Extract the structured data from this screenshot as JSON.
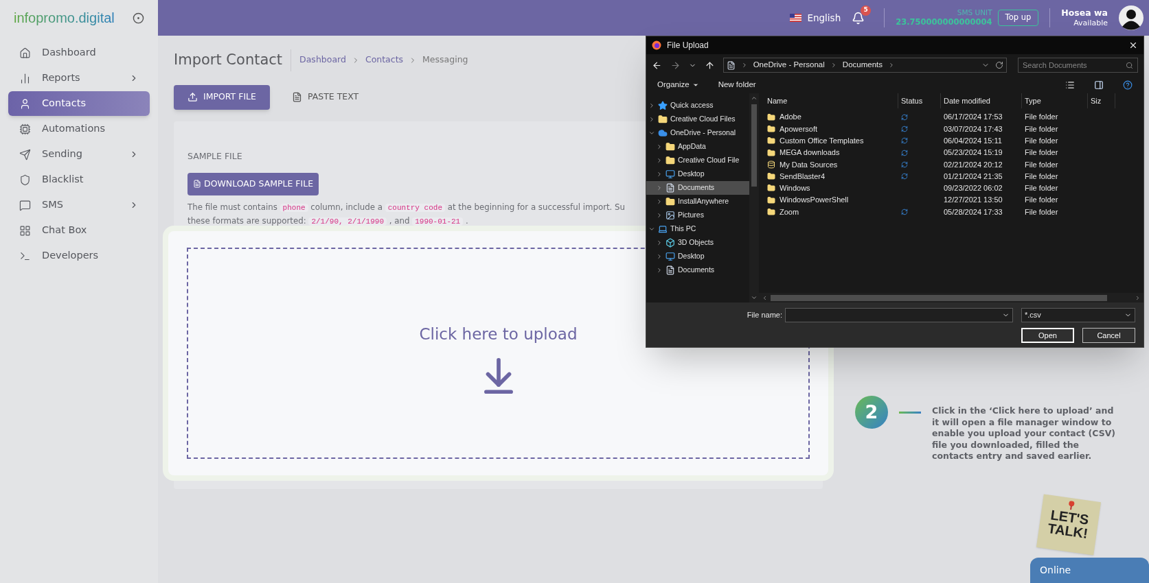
{
  "sidebar": {
    "logo": "infopromo.digital",
    "items": [
      {
        "label": "Dashboard",
        "submenu": false,
        "selected": false
      },
      {
        "label": "Reports",
        "submenu": true,
        "selected": false
      },
      {
        "label": "Contacts",
        "submenu": false,
        "selected": true
      },
      {
        "label": "Automations",
        "submenu": false,
        "selected": false
      },
      {
        "label": "Sending",
        "submenu": true,
        "selected": false
      },
      {
        "label": "Blacklist",
        "submenu": false,
        "selected": false
      },
      {
        "label": "SMS",
        "submenu": true,
        "selected": false
      },
      {
        "label": "Chat Box",
        "submenu": false,
        "selected": false
      },
      {
        "label": "Developers",
        "submenu": false,
        "selected": false
      }
    ]
  },
  "topbar": {
    "language": "English",
    "notifications": "5",
    "sms_label": "SMS UNIT",
    "sms_value": "23.750000000000004",
    "topup": "Top up",
    "user": "Hosea wa",
    "status": "Available"
  },
  "page": {
    "title": "Import Contact",
    "breadcrumbs": [
      {
        "label": "Dashboard",
        "link": true
      },
      {
        "label": "Contacts",
        "link": true
      },
      {
        "label": "Messaging",
        "link": false
      }
    ],
    "tabs": [
      {
        "label": "IMPORT FILE",
        "selected": true
      },
      {
        "label": "PASTE TEXT",
        "selected": false
      }
    ],
    "section_label": "SAMPLE FILE",
    "download_button": "DOWNLOAD SAMPLE FILE",
    "note_lines": [
      [
        {
          "kind": "text",
          "text": "The file must contains "
        },
        {
          "kind": "code",
          "text": "phone"
        },
        {
          "kind": "text",
          "text": " column, include a "
        },
        {
          "kind": "code",
          "text": "country code"
        },
        {
          "kind": "text",
          "text": " at the beginning for a successful import. Su"
        }
      ],
      [
        {
          "kind": "text",
          "text": "these formats are supported: "
        },
        {
          "kind": "code",
          "text": "2/1/90, 2/1/1990"
        },
        {
          "kind": "text",
          "text": " , and "
        },
        {
          "kind": "code",
          "text": "1990-01-21"
        },
        {
          "kind": "text",
          "text": " ."
        }
      ]
    ],
    "upload_text": "Click here to upload"
  },
  "dialog": {
    "title": "File Upload",
    "path": [
      "OneDrive - Personal",
      "Documents"
    ],
    "search_placeholder": "Search Documents",
    "toolbar": [
      {
        "label": "Organize",
        "dropdown": true
      },
      {
        "label": "New folder",
        "dropdown": false
      }
    ],
    "columns": [
      "Name",
      "Status",
      "Date modified",
      "Type",
      "Siz"
    ],
    "tree": [
      {
        "label": "Quick access",
        "kind": "star",
        "expanded": false,
        "selected": false
      },
      {
        "label": "Creative Cloud Files",
        "kind": "folder",
        "expanded": false,
        "selected": false
      },
      {
        "label": "OneDrive - Personal",
        "kind": "cloud",
        "expanded": true,
        "selected": false,
        "children": [
          {
            "label": "AppData",
            "kind": "folder",
            "expanded": false,
            "selected": false
          },
          {
            "label": "Creative Cloud File",
            "kind": "folder",
            "expanded": false,
            "selected": false
          },
          {
            "label": "Desktop",
            "kind": "desktop",
            "expanded": false,
            "selected": false
          },
          {
            "label": "Documents",
            "kind": "document",
            "expanded": false,
            "selected": true
          },
          {
            "label": "InstallAnywhere",
            "kind": "folder",
            "expanded": false,
            "selected": false
          },
          {
            "label": "Pictures",
            "kind": "picture",
            "expanded": false,
            "selected": false
          }
        ]
      },
      {
        "label": "This PC",
        "kind": "pc",
        "expanded": true,
        "selected": false,
        "children": [
          {
            "label": "3D Objects",
            "kind": "cube",
            "expanded": false,
            "selected": false
          },
          {
            "label": "Desktop",
            "kind": "desktop",
            "expanded": false,
            "selected": false
          },
          {
            "label": "Documents",
            "kind": "document",
            "expanded": false,
            "selected": false
          }
        ]
      }
    ],
    "files": [
      {
        "name": "Adobe",
        "kind": "folder",
        "synced": true,
        "date": "06/17/2024 17:53",
        "type": "File folder"
      },
      {
        "name": "Apowersoft",
        "kind": "folder",
        "synced": true,
        "date": "03/07/2024 17:43",
        "type": "File folder"
      },
      {
        "name": "Custom Office Templates",
        "kind": "folder",
        "synced": true,
        "date": "06/04/2024 15:11",
        "type": "File folder"
      },
      {
        "name": "MEGA downloads",
        "kind": "folder",
        "synced": true,
        "date": "05/23/2024 15:19",
        "type": "File folder"
      },
      {
        "name": "My Data Sources",
        "kind": "datasource",
        "synced": true,
        "date": "02/21/2024 20:12",
        "type": "File folder"
      },
      {
        "name": "SendBlaster4",
        "kind": "folder",
        "synced": true,
        "date": "01/21/2024 21:35",
        "type": "File folder"
      },
      {
        "name": "Windows",
        "kind": "folder",
        "synced": false,
        "date": "09/23/2022 06:02",
        "type": "File folder"
      },
      {
        "name": "WindowsPowerShell",
        "kind": "folder",
        "synced": false,
        "date": "12/27/2021 13:50",
        "type": "File folder"
      },
      {
        "name": "Zoom",
        "kind": "folder",
        "synced": true,
        "date": "05/28/2024 17:33",
        "type": "File folder"
      }
    ],
    "filename_label": "File name:",
    "filter": "*.csv",
    "buttons": [
      {
        "label": "Open",
        "default": true
      },
      {
        "label": "Cancel",
        "default": false
      }
    ]
  },
  "tutorial": {
    "step": "2",
    "text": "Click in the ‘Click here to upload’ and it will open a file manager window to enable you upload your contact (CSV) file you downloaded, filled the contacts entry and saved earlier."
  },
  "chat": {
    "note": "LET'S TALK!",
    "status": "Online"
  }
}
